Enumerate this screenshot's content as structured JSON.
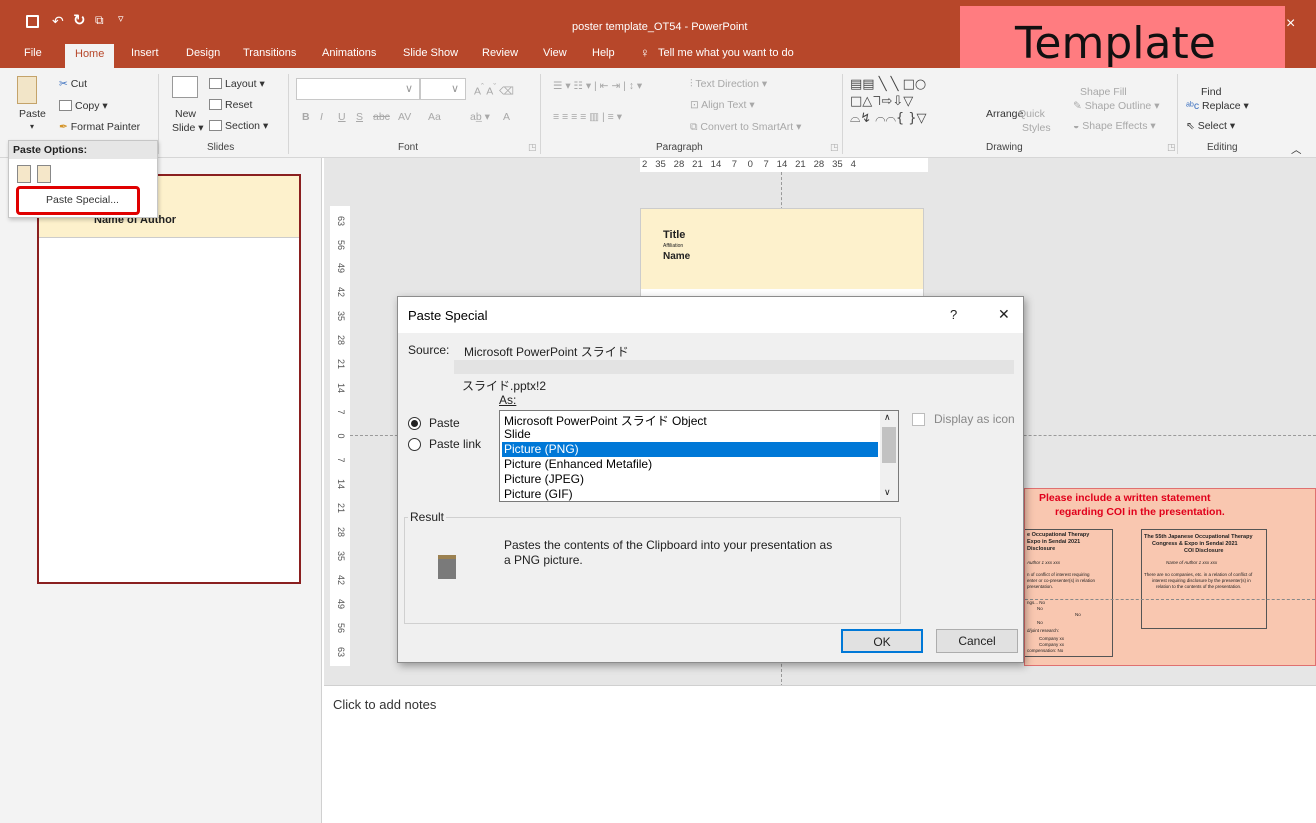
{
  "window": {
    "title": "poster template_OT54  -  PowerPoint",
    "close_glyph": "×"
  },
  "overlay": {
    "template_label": "Template"
  },
  "tabs": [
    "File",
    "Home",
    "Insert",
    "Design",
    "Transitions",
    "Animations",
    "Slide Show",
    "Review",
    "View",
    "Help",
    "Tell me what you want to do"
  ],
  "ribbon": {
    "clipboard": {
      "paste": "Paste",
      "cut": "Cut",
      "copy": "Copy",
      "format_painter": "Format Painter"
    },
    "slides": {
      "new_slide_1": "New",
      "new_slide_2": "Slide",
      "layout": "Layout",
      "reset": "Reset",
      "section": "Section",
      "label": "Slides"
    },
    "font": {
      "label": "Font",
      "buttons": [
        "B",
        "I",
        "U",
        "S",
        "abc",
        "AV",
        "Aa",
        "A"
      ]
    },
    "paragraph": {
      "label": "Paragraph",
      "text_direction": "Text Direction",
      "align_text": "Align Text",
      "convert_smartart": "Convert to SmartArt"
    },
    "drawing": {
      "label": "Drawing",
      "arrange": "Arrange",
      "quick_1": "Quick",
      "quick_2": "Styles",
      "shape_fill": "Shape Fill",
      "shape_outline": "Shape Outline",
      "shape_effects": "Shape Effects"
    },
    "editing": {
      "label": "Editing",
      "find": "Find",
      "replace": "Replace",
      "select": "Select"
    }
  },
  "paste_menu": {
    "header": "Paste Options:",
    "paste_special": "Paste Special..."
  },
  "ruler_top": "2   35   28   21   14    7    0    7   14   21   28   35   4",
  "ruler_left": [
    "63",
    "56",
    "49",
    "42",
    "35",
    "28",
    "21",
    "14",
    "7",
    "0",
    "7",
    "14",
    "21",
    "28",
    "35",
    "42",
    "49",
    "56",
    "63"
  ],
  "thumbnail": {
    "author": "Name of Author"
  },
  "slide": {
    "title": "Title",
    "affiliation": "Affiliation",
    "name": "Name"
  },
  "coi": {
    "heading_1": "Please include a written statement",
    "heading_2": "regarding COI in the presentation.",
    "left_1": "e Occupational Therapy",
    "left_2": "Expo in Sendai 2021",
    "left_3": "Disclosure",
    "left_4": "Author 1   xxx xxx",
    "left_5": "n of conflict of interest requiring",
    "left_6": "enter or co-presenter(s) in relation",
    "left_7": "presentation.",
    "left_8": "ngs... No",
    "left_9": "No",
    "left_10": "No",
    "left_11": "No",
    "left_12": "d/joint research:",
    "left_13": "Company xx",
    "left_14": "Company xx",
    "left_15": "compensation: No",
    "right_1": "The 55th Japanese Occupational Therapy",
    "right_2": "Congress & Expo in Sendai 2021",
    "right_3": "COI   Disclosure",
    "right_4": "Name of Author 1   xxx xxx",
    "right_5": "There are no companies, etc. in a relation of conflict of",
    "right_6": "interest requiring disclosure by the presenter(s) in",
    "right_7": "relation to the contents of the presentation."
  },
  "dialog": {
    "title": "Paste Special",
    "help": "?",
    "close": "✕",
    "source_label": "Source:",
    "source_value": "Microsoft PowerPoint スライド",
    "file_ref": "スライド.pptx!2",
    "as_label": "As:",
    "paste_option": "Paste",
    "paste_link_option": "Paste link",
    "options": [
      "Microsoft PowerPoint スライド Object",
      "Slide",
      "Picture (PNG)",
      "Picture (Enhanced Metafile)",
      "Picture (JPEG)",
      "Picture (GIF)"
    ],
    "selected_index": 2,
    "display_as_icon": "Display as icon",
    "result_label": "Result",
    "result_text_1": "Pastes the contents of the Clipboard into your presentation as",
    "result_text_2": "a PNG picture.",
    "ok": "OK",
    "cancel": "Cancel"
  },
  "notes": {
    "placeholder": "Click to add notes"
  },
  "colors": {
    "accent": "#b7472a",
    "highlight": "#0078d7",
    "template_bg": "#ff7c80",
    "coi_bg": "#f9c7b0",
    "coi_red": "#e0001b",
    "title_fill": "#fdf1cc",
    "callout": "#e00000"
  }
}
